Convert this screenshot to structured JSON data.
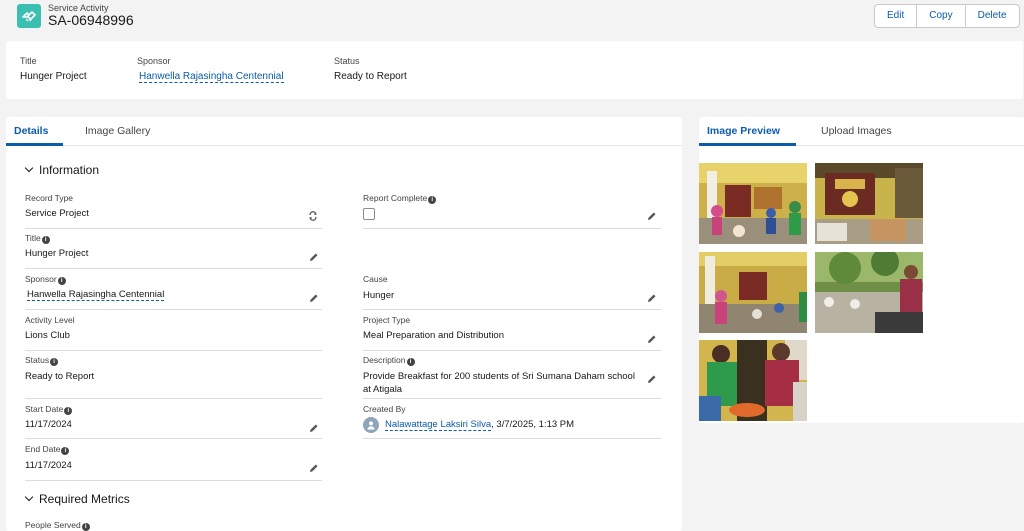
{
  "header": {
    "object_label": "Service Activity",
    "record_name": "SA-06948996",
    "actions": [
      "Edit",
      "Copy",
      "Delete"
    ]
  },
  "highlights": {
    "title_label": "Title",
    "title_value": "Hunger Project",
    "sponsor_label": "Sponsor",
    "sponsor_value": "Hanwella Rajasingha Centennial",
    "status_label": "Status",
    "status_value": "Ready to Report"
  },
  "left_tabs": [
    "Details",
    "Image Gallery"
  ],
  "right_tabs": [
    "Image Preview",
    "Upload Images"
  ],
  "sections": {
    "information": "Information",
    "required_metrics": "Required Metrics"
  },
  "fields": {
    "record_type_label": "Record Type",
    "record_type_value": "Service Project",
    "report_complete_label": "Report Complete",
    "title_label": "Title",
    "title_value": "Hunger Project",
    "sponsor_label": "Sponsor",
    "sponsor_value": "Hanwella Rajasingha Centennial",
    "cause_label": "Cause",
    "cause_value": "Hunger",
    "activity_level_label": "Activity Level",
    "activity_level_value": "Lions Club",
    "project_type_label": "Project Type",
    "project_type_value": "Meal Preparation and Distribution",
    "status_label": "Status",
    "status_value": "Ready to Report",
    "description_label": "Description",
    "description_value": "Provide Breakfast for 200 students of Sri Sumana Daham school at Atigala",
    "start_date_label": "Start Date",
    "start_date_value": "11/17/2024",
    "created_by_label": "Created By",
    "created_by_name": "Nalawattage Laksiri Silva",
    "created_by_date": ", 3/7/2025, 1:13 PM",
    "end_date_label": "End Date",
    "end_date_value": "11/17/2024",
    "people_served_label": "People Served"
  },
  "info_glyph": "i",
  "colors": {
    "accent": "#0b5cab",
    "object_icon": "#3bbfb0"
  }
}
